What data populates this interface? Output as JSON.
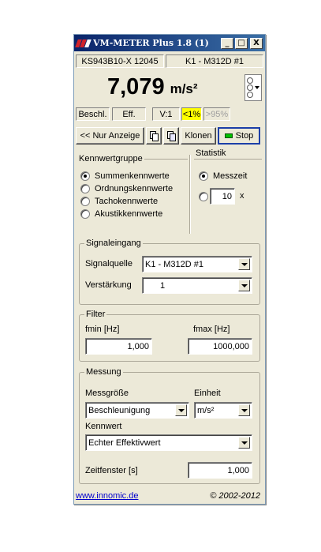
{
  "window": {
    "title": "VM-METER Plus 1.8 (1)",
    "minimize": "_",
    "maximize": "□",
    "close": "X"
  },
  "header": {
    "serial": "KS943B10-X 12045",
    "channel": "K1 - M312D #1"
  },
  "display": {
    "value": "7,079",
    "unit": "m/s²",
    "quantity": "Beschl.",
    "mode": "Eff.",
    "range": "V:1",
    "warning": "<1%",
    "overload": ">95%",
    "warning_color": "#ffff00"
  },
  "toolbar": {
    "display_only": "<< Nur Anzeige",
    "clone": "Klonen",
    "stop": "Stop"
  },
  "kennwertgruppe": {
    "legend": "Kennwertgruppe",
    "options": [
      "Summenkennwerte",
      "Ordnungskennwerte",
      "Tachokennwerte",
      "Akustikkennwerte"
    ],
    "selected": 0
  },
  "statistik": {
    "legend": "Statistik",
    "option_messzeit": "Messzeit",
    "count": "10",
    "count_suffix": "x"
  },
  "signaleingang": {
    "legend": "Signaleingang",
    "source_label": "Signalquelle",
    "source_value": "K1 - M312D #1",
    "gain_label": "Verstärkung",
    "gain_value": "1"
  },
  "filter": {
    "legend": "Filter",
    "fmin_label": "fmin [Hz]",
    "fmin_value": "1,000",
    "fmax_label": "fmax [Hz]",
    "fmax_value": "1000,000"
  },
  "messung": {
    "legend": "Messung",
    "quantity_label": "Messgröße",
    "quantity_value": "Beschleunigung",
    "unit_label": "Einheit",
    "unit_value": "m/s²",
    "kennwert_label": "Kennwert",
    "kennwert_value": "Echter Effektivwert",
    "window_label": "Zeitfenster [s]",
    "window_value": "1,000"
  },
  "footer": {
    "link": "www.innomic.de",
    "copyright": "© 2002-2012"
  },
  "colors": {
    "title_start": "#0a246a",
    "title_end": "#3a6ea5",
    "stop_led": "#00c000",
    "link": "#0000cc",
    "logo": "#d2232a"
  }
}
